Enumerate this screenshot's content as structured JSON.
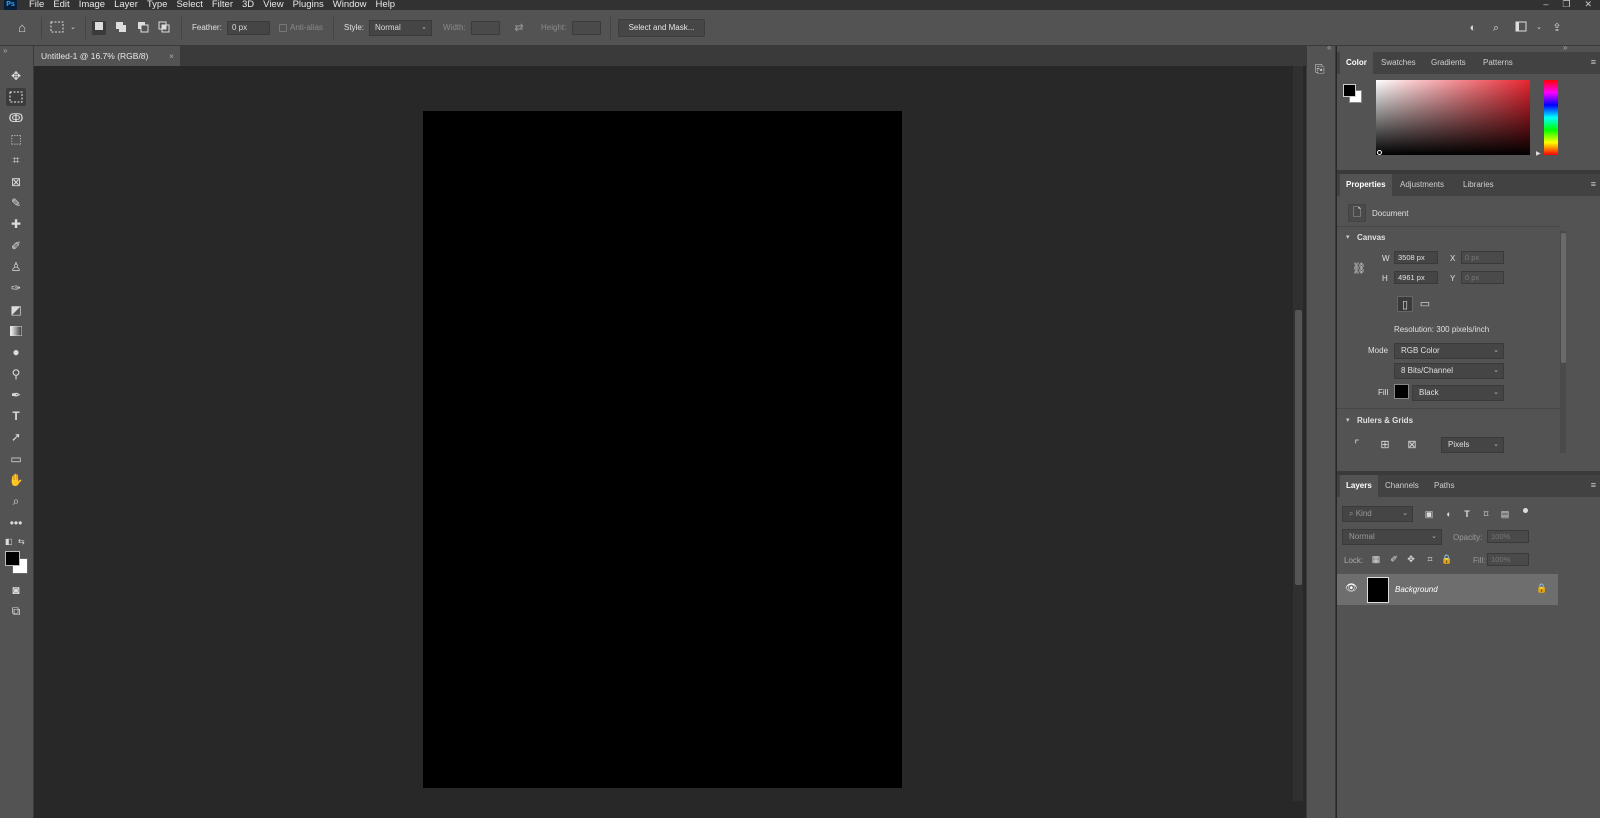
{
  "app": {
    "logo": "Ps"
  },
  "menu": [
    "File",
    "Edit",
    "Image",
    "Layer",
    "Type",
    "Select",
    "Filter",
    "3D",
    "View",
    "Plugins",
    "Window",
    "Help"
  ],
  "window_controls": {
    "minimize": "–",
    "restore": "❐",
    "close": "✕"
  },
  "options": {
    "feather_label": "Feather:",
    "feather_value": "0 px",
    "antialias_label": "Anti-alias",
    "style_label": "Style:",
    "style_value": "Normal",
    "width_label": "Width:",
    "height_label": "Height:",
    "select_mask_label": "Select and Mask..."
  },
  "document_tab": {
    "title": "Untitled-1 @ 16.7% (RGB/8)",
    "close": "×"
  },
  "color_panel": {
    "tabs": [
      "Color",
      "Swatches",
      "Gradients",
      "Patterns"
    ],
    "active": "Color"
  },
  "properties_panel": {
    "tabs": [
      "Properties",
      "Adjustments",
      "Libraries"
    ],
    "document_label": "Document",
    "canvas_header": "Canvas",
    "w_label": "W",
    "w_value": "3508 px",
    "h_label": "H",
    "h_value": "4961 px",
    "x_label": "X",
    "x_value": "0 px",
    "y_label": "Y",
    "y_value": "0 px",
    "resolution": "Resolution: 300 pixels/inch",
    "mode_label": "Mode",
    "mode_value": "RGB Color",
    "bits_value": "8 Bits/Channel",
    "fill_label": "Fill",
    "fill_value": "Black",
    "rulers_header": "Rulers & Grids",
    "units_value": "Pixels"
  },
  "layers_panel": {
    "tabs": [
      "Layers",
      "Channels",
      "Paths"
    ],
    "filter_placeholder": "Kind",
    "blend_mode": "Normal",
    "opacity_label": "Opacity:",
    "opacity_value": "100%",
    "lock_label": "Lock:",
    "fill_label": "Fill:",
    "fill_value": "100%",
    "layers": [
      {
        "name": "Background",
        "visible": true,
        "locked": true
      }
    ]
  },
  "colors": {
    "foreground": "#000000",
    "background": "#ffffff",
    "panel_bg": "#535353",
    "canvas_bg": "#282828",
    "document_fill": "#000000",
    "selected_layer": "#6e6e6e"
  }
}
